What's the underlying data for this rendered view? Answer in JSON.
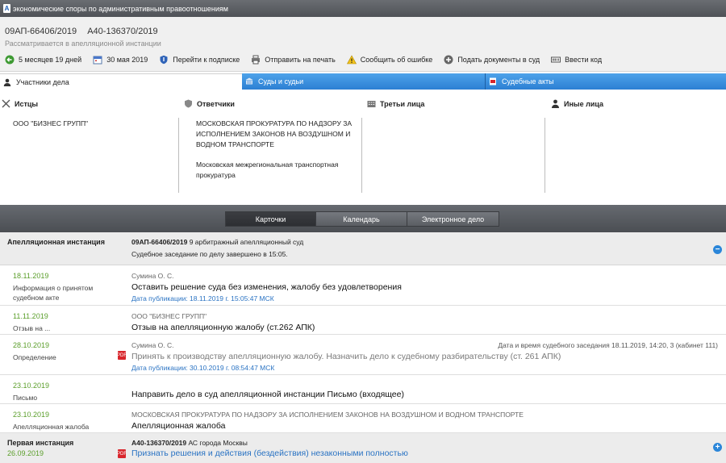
{
  "window": {
    "title": "экономические споры по административным правоотношениям",
    "app_icon_letter": "A"
  },
  "case": {
    "number_appeal": "09АП-66406/2019",
    "number_first": "А40-136370/2019",
    "status": "Рассматривается в апелляционной инстанции"
  },
  "toolbar": {
    "duration": "5 месяцев 19 дней",
    "date": "30 мая 2019",
    "subscribe": "Перейти к подписке",
    "print": "Отправить на печать",
    "report_error": "Сообщить об ошибке",
    "submit_docs": "Подать документы в суд",
    "enter_code": "Ввести код"
  },
  "tabs": {
    "participants": "Участники дела",
    "courts": "Суды и судьи",
    "acts": "Судебные акты"
  },
  "parties": {
    "plaintiffs": {
      "header": "Истцы",
      "items": [
        "ООО \"БИЗНЕС ГРУПП\""
      ]
    },
    "defendants": {
      "header": "Ответчики",
      "items": [
        "МОСКОВСКАЯ ПРОКУРАТУРА ПО НАДЗОРУ ЗА ИСПОЛНЕНИЕМ ЗАКОНОВ НА ВОЗДУШНОМ И ВОДНОМ ТРАНСПОРТЕ",
        "Московская межрегиональная транспортная прокуратура"
      ]
    },
    "third": {
      "header": "Третьи лица"
    },
    "other": {
      "header": "Иные лица"
    }
  },
  "views": {
    "cards": "Карточки",
    "calendar": "Календарь",
    "ecase": "Электронное дело"
  },
  "appeal": {
    "name": "Апелляционная инстанция",
    "case_no": "09АП-66406/2019",
    "court": "9 арбитражный апелляционный суд",
    "status": "Судебное заседание по делу завершено в 15:05.",
    "toggle": "−"
  },
  "events": [
    {
      "date": "18.11.2019",
      "type": "Информация о принятом судебном акте",
      "who": "Сумина О. С.",
      "what": "Оставить решение суда без изменения, жалобу без удовлетворения",
      "pub": "Дата публикации: 18.11.2019 г. 15:05:47 МСК"
    },
    {
      "date": "11.11.2019",
      "type": "Отзыв на ...",
      "who": "ООО \"БИЗНЕС ГРУПП\"",
      "what": "Отзыв на апелляционную жалобу (ст.262 АПК)"
    },
    {
      "date": "28.10.2019",
      "type": "Определение",
      "who": "Сумина О. С.",
      "what": "Принять к производству апелляционную жалобу. Назначить дело к судебному разбирательству (ст. 261 АПК)",
      "pub": "Дата публикации: 30.10.2019 г. 08:54:47 МСК",
      "right": "Дата и время судебного заседания 18.11.2019, 14:20, 3 (кабинет 111)"
    },
    {
      "date": "23.10.2019",
      "type": "Письмо",
      "what": "Направить дело в суд апелляционной инстанции Письмо (входящее)"
    },
    {
      "date": "23.10.2019",
      "type": "Апелляционная жалоба",
      "who": "МОСКОВСКАЯ ПРОКУРАТУРА ПО НАДЗОРУ ЗА ИСПОЛНЕНИЕМ ЗАКОНОВ НА ВОЗДУШНОМ И ВОДНОМ ТРАНСПОРТЕ",
      "what": "Апелляционная жалоба"
    }
  ],
  "first": {
    "name": "Первая инстанция",
    "date": "26.09.2019",
    "case_no": "А40-136370/2019",
    "court": "АС города Москвы",
    "decision": "Признать решения и действия (бездействия) незаконными полностью",
    "toggle": "+"
  },
  "pdf_label": "PDF",
  "colors": {
    "tab_blue": "#2c7fd3",
    "date_green": "#5a9e2a",
    "link_blue": "#2a73c3"
  }
}
